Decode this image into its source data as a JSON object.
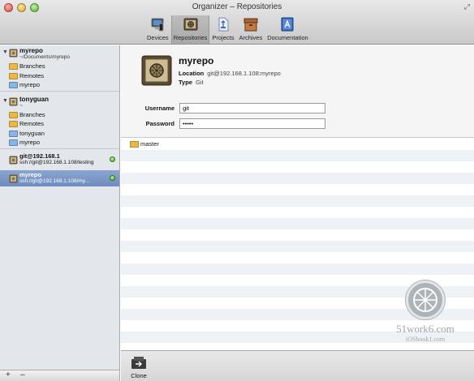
{
  "window": {
    "title": "Organizer – Repositories"
  },
  "toolbar": {
    "items": [
      {
        "label": "Devices",
        "icon": "devices-icon"
      },
      {
        "label": "Repositories",
        "icon": "vault-icon",
        "selected": true
      },
      {
        "label": "Projects",
        "icon": "projects-icon"
      },
      {
        "label": "Archives",
        "icon": "archives-icon"
      },
      {
        "label": "Documentation",
        "icon": "documentation-icon"
      }
    ]
  },
  "sidebar": {
    "repo1": {
      "name": "myrepo",
      "path": "~/Documents/myrepo",
      "items": [
        "Branches",
        "Remotes",
        "myrepo"
      ]
    },
    "repo2": {
      "name": "tonyguan",
      "path": "~",
      "items": [
        "Branches",
        "Remotes",
        "tonyguan",
        "myrepo"
      ]
    },
    "remote1": {
      "name": "git@192.168.1",
      "url": "ssh://git@192.168.1.108/testing"
    },
    "remote2": {
      "name": "myrepo",
      "url": "ssh://git@192.168.1.108/my..."
    },
    "footer": {
      "add": "+",
      "remove": "–"
    }
  },
  "detail": {
    "name": "myrepo",
    "location_label": "Location",
    "location": "git@192.168.1.108:myrepo",
    "type_label": "Type",
    "type": "Git",
    "username_label": "Username",
    "username": "git",
    "password_label": "Password",
    "password": "•••••"
  },
  "branches": [
    "master"
  ],
  "bottom": {
    "clone_label": "Clone"
  },
  "watermark": {
    "line1": "51work6.com",
    "line2": "iOSbook1.com"
  }
}
